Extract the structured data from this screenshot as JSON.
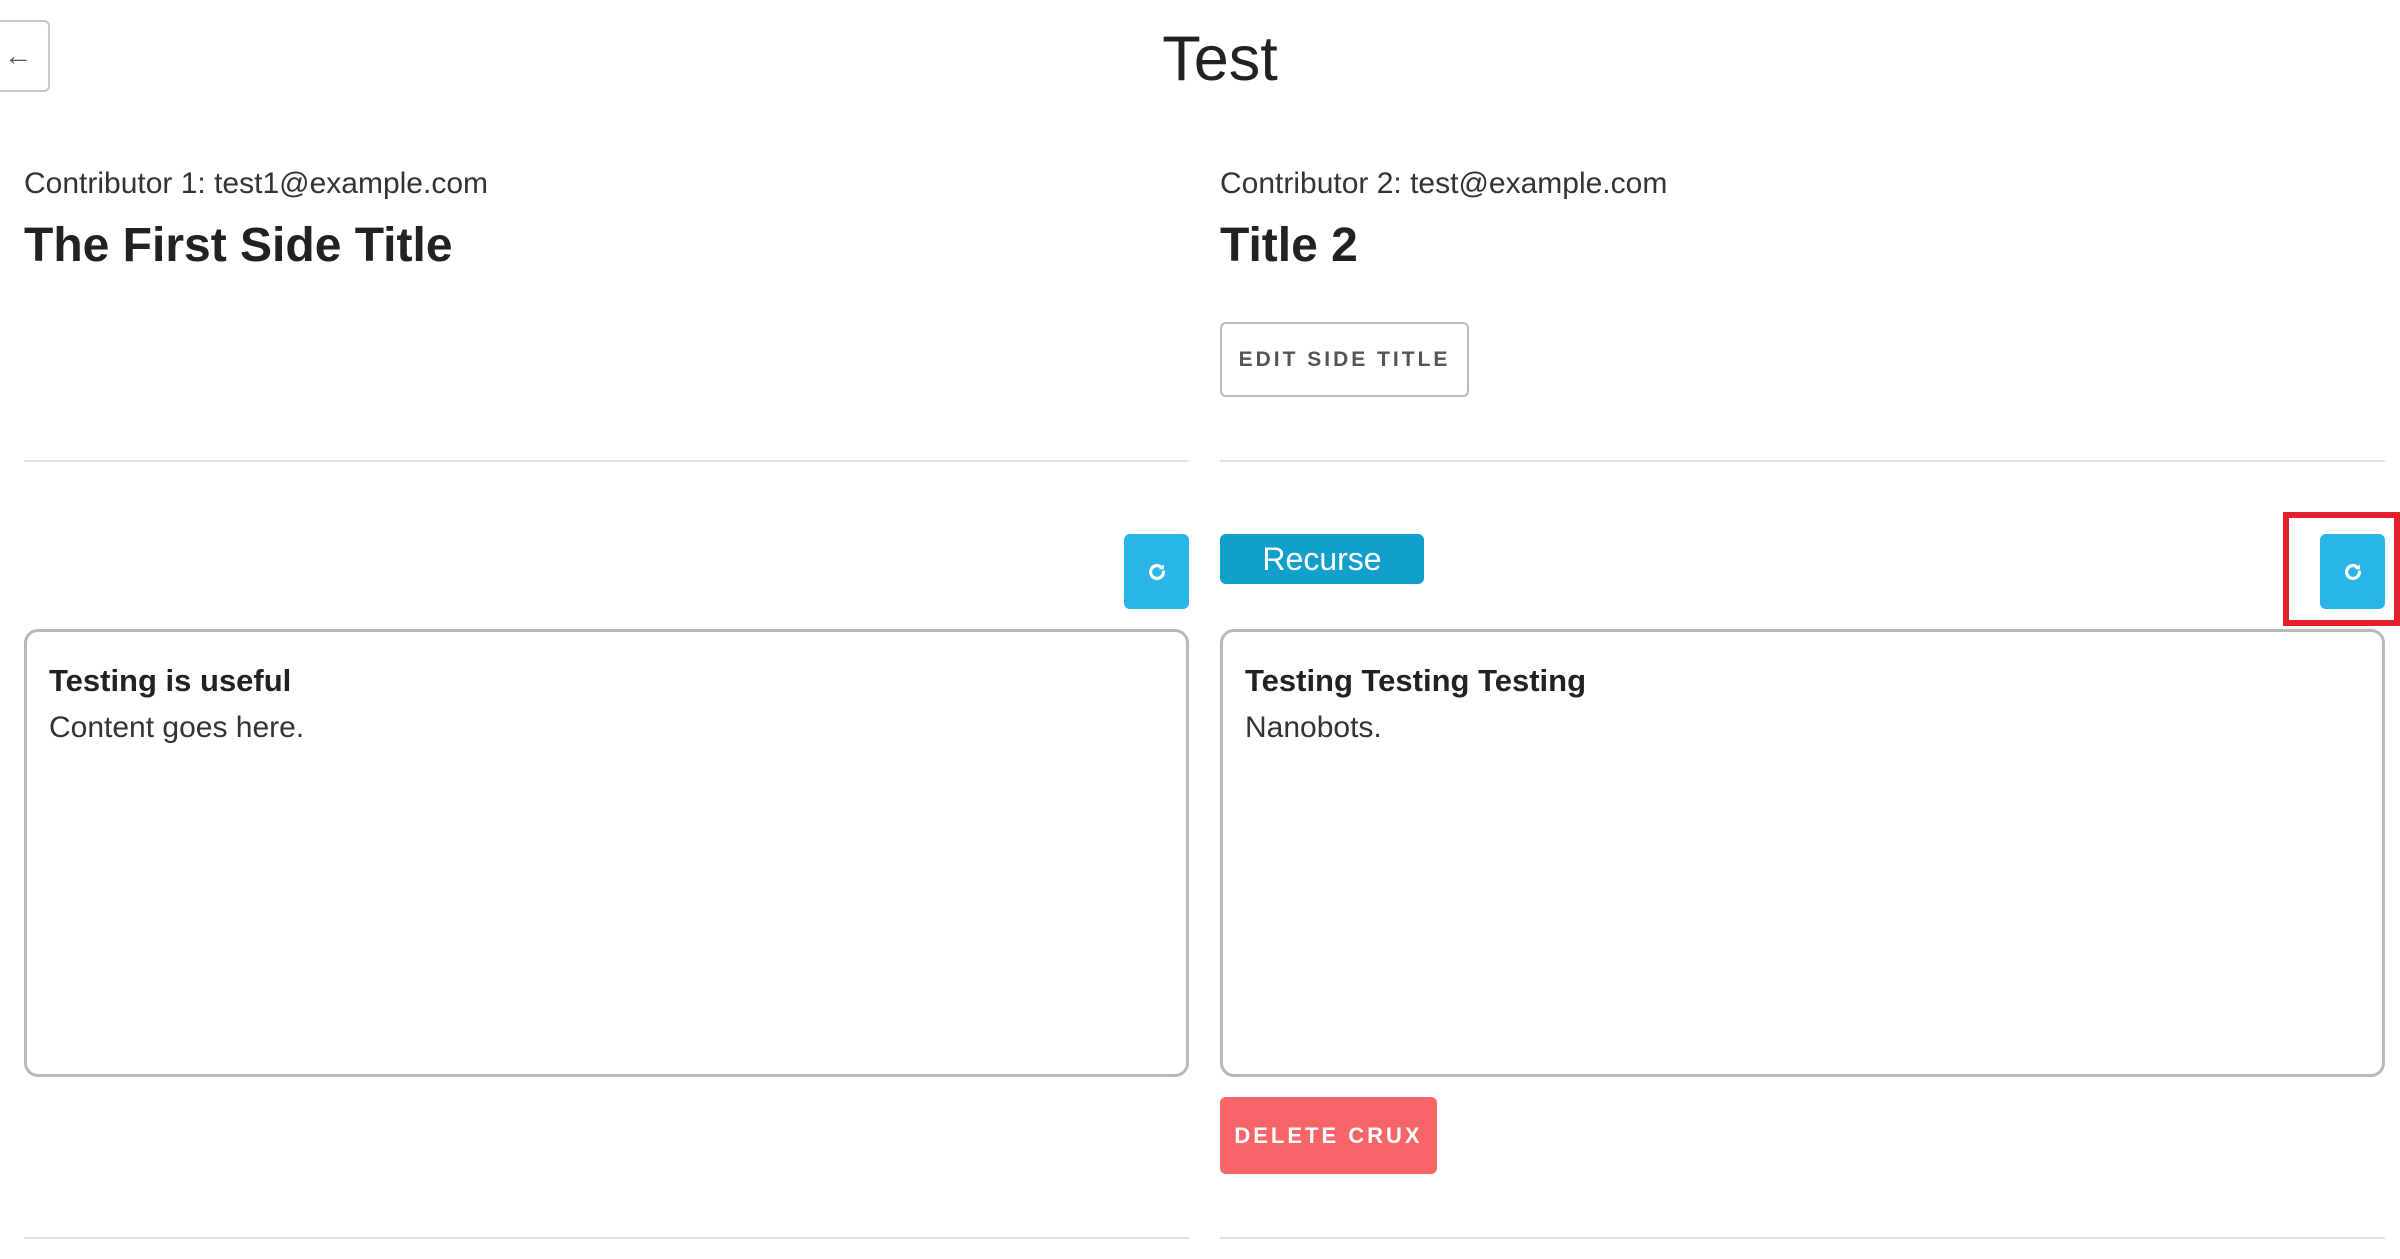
{
  "header": {
    "back_label": "←",
    "title": "Test"
  },
  "left_side": {
    "contributor": "Contributor 1: test1@example.com",
    "title": "The First Side Title",
    "refresh_icon": "refresh-icon",
    "crux": {
      "title": "Testing is useful",
      "content": "Content goes here."
    }
  },
  "right_side": {
    "contributor": "Contributor 2: test@example.com",
    "title": "Title 2",
    "edit_title_label": "EDIT SIDE TITLE",
    "recurse_label": "Recurse",
    "refresh_icon": "refresh-icon",
    "crux": {
      "title": "Testing Testing Testing",
      "content": "Nanobots."
    },
    "delete_label": "DELETE CRUX"
  },
  "colors": {
    "refresh_button": "#29b6e4",
    "recurse_button": "#139fcb",
    "delete_button": "#f66669",
    "highlight": "#e3202b"
  }
}
